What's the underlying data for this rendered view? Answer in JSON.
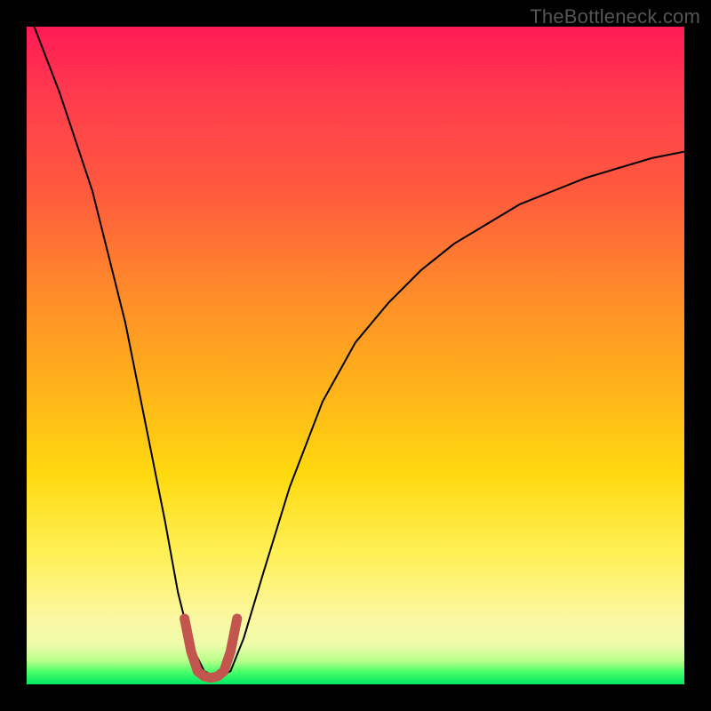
{
  "watermark": "TheBottleneck.com",
  "chart_data": {
    "type": "line",
    "title": "",
    "xlabel": "",
    "ylabel": "",
    "xlim": [
      0,
      100
    ],
    "ylim": [
      0,
      100
    ],
    "series": [
      {
        "name": "bottleneck-curve",
        "x": [
          0,
          5,
          10,
          15,
          18,
          21,
          23,
          25,
          27,
          29,
          31,
          33,
          36,
          40,
          45,
          50,
          55,
          60,
          65,
          70,
          75,
          80,
          85,
          90,
          95,
          100
        ],
        "values": [
          103,
          90,
          75,
          55,
          40,
          25,
          14,
          6,
          2,
          1,
          2,
          7,
          17,
          30,
          43,
          52,
          58,
          63,
          67,
          70,
          73,
          75,
          77,
          78.5,
          80,
          81
        ]
      },
      {
        "name": "optimal-zone-marker",
        "x": [
          24,
          25,
          26,
          27,
          28,
          29,
          30,
          31,
          32
        ],
        "values": [
          10,
          5,
          2,
          1.2,
          1.0,
          1.2,
          2,
          5,
          10
        ]
      }
    ],
    "colors": {
      "curve": "#000000",
      "marker": "#c3554f",
      "gradient_top": "#ff1a55",
      "gradient_mid": "#ffd90f",
      "gradient_bottom": "#00e864"
    }
  }
}
